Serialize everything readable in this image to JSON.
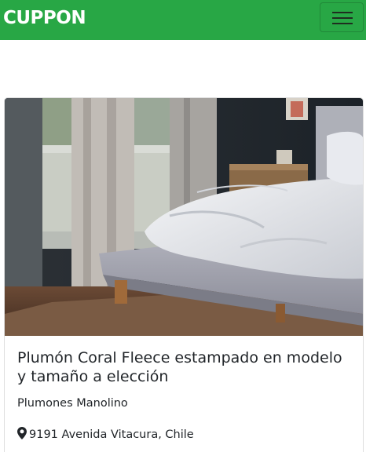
{
  "navbar": {
    "brand": "CUPPON",
    "color": "#28a745",
    "menu_icon": "hamburger-menu-icon"
  },
  "card": {
    "image_icon": "bedroom-photo",
    "title": "Plumón Coral Fleece estampado en modelo y tamaño a elección",
    "merchant": "Plumones Manolino",
    "location_icon": "map-marker-icon",
    "location": "9191 Avenida Vitacura, Chile"
  }
}
